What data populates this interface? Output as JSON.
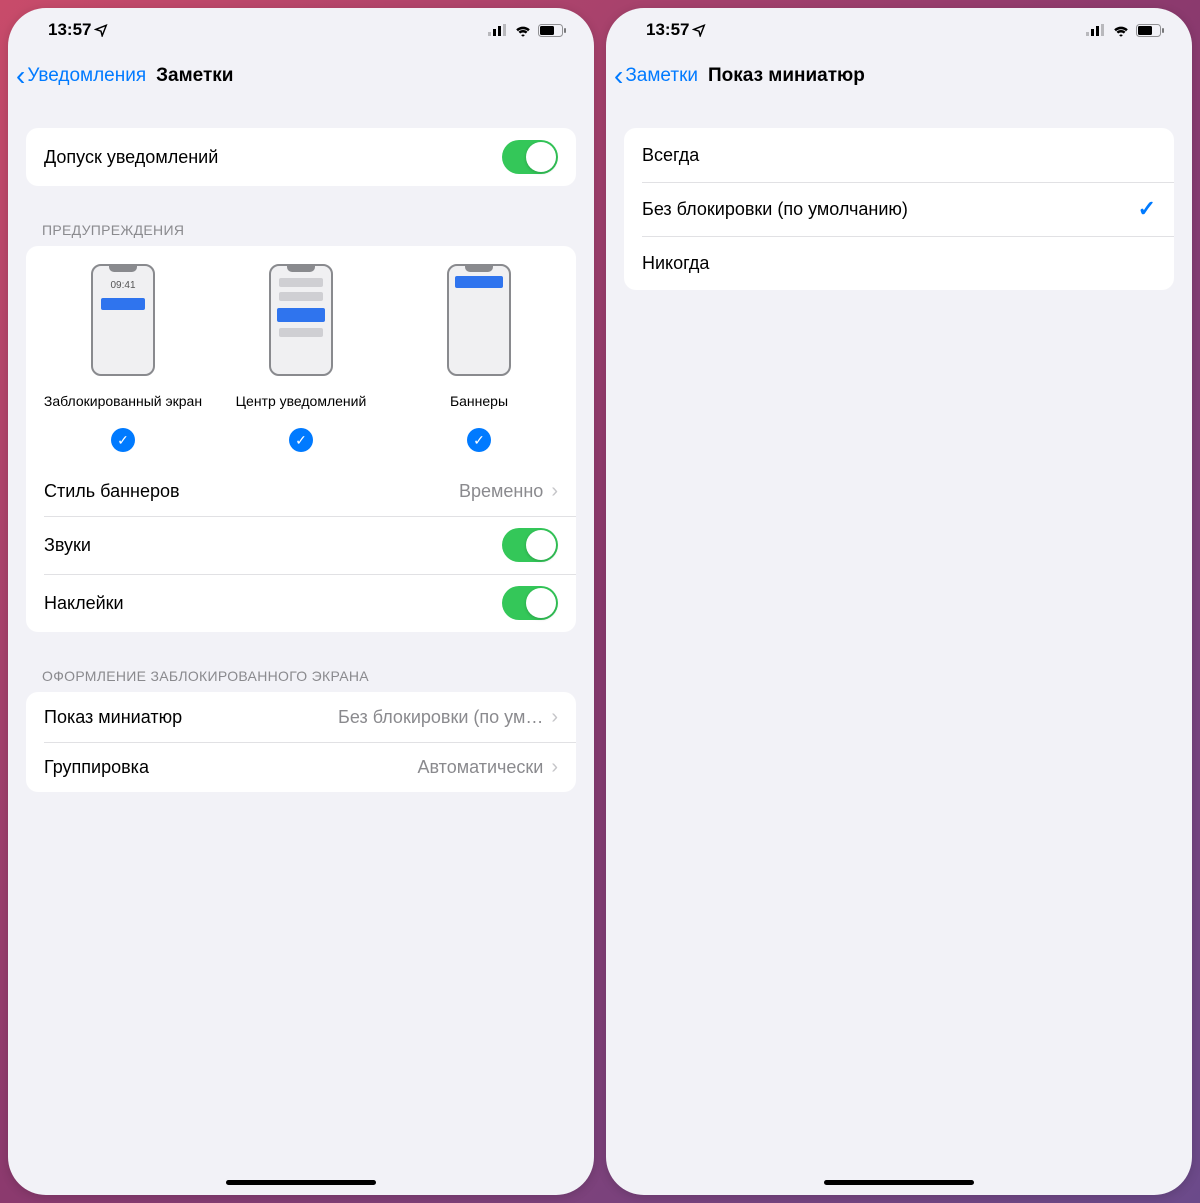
{
  "status": {
    "time": "13:57"
  },
  "left": {
    "nav": {
      "back": "Уведомления",
      "title": "Заметки"
    },
    "allow": {
      "label": "Допуск уведомлений",
      "on": true
    },
    "alerts": {
      "header": "ПРЕДУПРЕЖДЕНИЯ",
      "mock_time": "09:41",
      "options": [
        {
          "label": "Заблокированный экран",
          "checked": true
        },
        {
          "label": "Центр уведомлений",
          "checked": true
        },
        {
          "label": "Баннеры",
          "checked": true
        }
      ],
      "banner_style": {
        "label": "Стиль баннеров",
        "value": "Временно"
      },
      "sounds": {
        "label": "Звуки",
        "on": true
      },
      "badges": {
        "label": "Наклейки",
        "on": true
      }
    },
    "lockscreen": {
      "header": "ОФОРМЛЕНИЕ ЗАБЛОКИРОВАННОГО ЭКРАНА",
      "previews": {
        "label": "Показ миниатюр",
        "value": "Без блокировки (по ум…"
      },
      "grouping": {
        "label": "Группировка",
        "value": "Автоматически"
      }
    }
  },
  "right": {
    "nav": {
      "back": "Заметки",
      "title": "Показ миниатюр"
    },
    "options": [
      {
        "label": "Всегда",
        "selected": false
      },
      {
        "label": "Без блокировки (по умолчанию)",
        "selected": true
      },
      {
        "label": "Никогда",
        "selected": false
      }
    ]
  }
}
